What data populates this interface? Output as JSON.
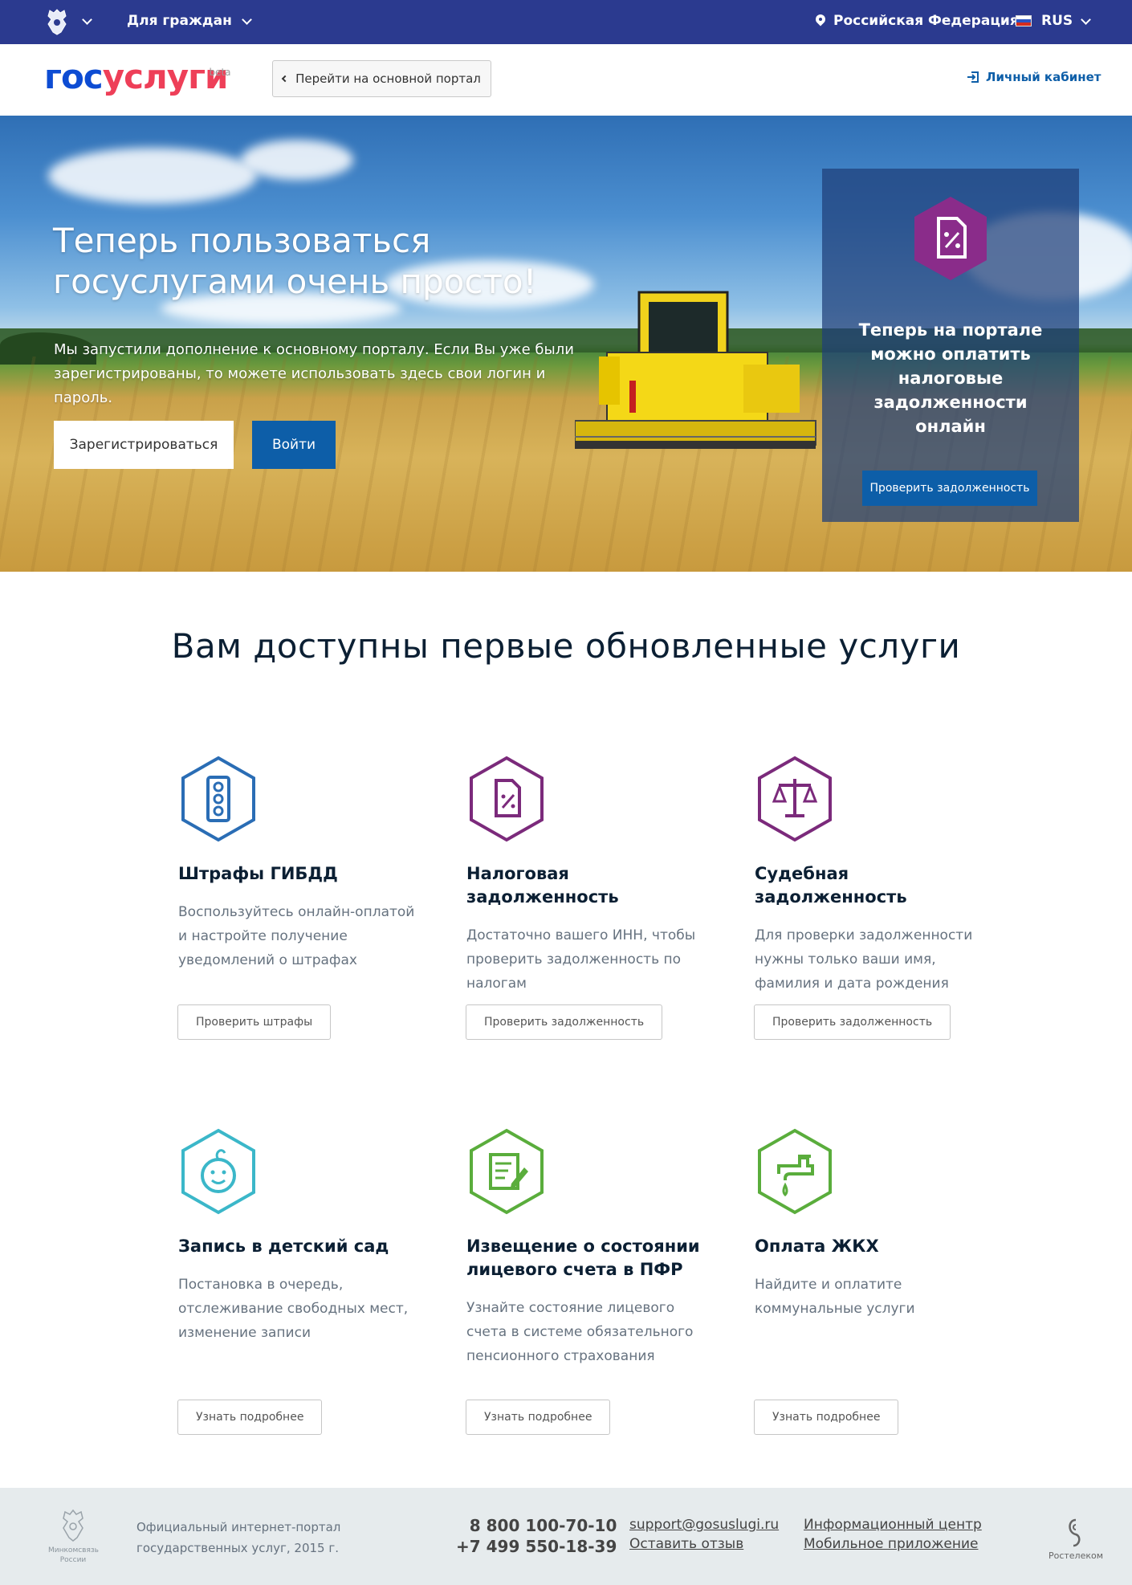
{
  "topbar": {
    "citizens_label": "Для граждан",
    "region_label": "Российская Федерация",
    "lang_label": "RUS"
  },
  "header": {
    "logo_part1": "гос",
    "logo_part2": "услуги",
    "logo_beta": "beta",
    "back_button": "Перейти на основной портал",
    "cabinet_link": "Личный кабинет"
  },
  "hero": {
    "title_line1": "Теперь пользоваться",
    "title_line2": "госуслугами очень просто!",
    "text": "Мы запустили дополнение к основному порталу. Если Вы уже были зарегистрированы, то можете использовать здесь свои логин и пароль.",
    "register_button": "Зарегистрироваться",
    "login_button": "Войти",
    "promo_title": "Теперь на портале можно оплатить налоговые задолженности онлайн",
    "promo_button": "Проверить задолженность",
    "promo_icon_color": "#8a2c8a"
  },
  "services": {
    "title": "Вам доступны первые обновленные услуги",
    "items": [
      {
        "title": "Штрафы ГИБДД",
        "desc": "Воспользуйтесь онлайн-оплатой и настройте получение уведомлений о штрафах",
        "button": "Проверить штрафы",
        "icon": "traffic-light-icon",
        "color": "#2a6db5"
      },
      {
        "title": "Налоговая задолженность",
        "desc": "Достаточно вашего ИНН, чтобы проверить задолженность по налогам",
        "button": "Проверить задолженность",
        "icon": "tax-document-icon",
        "color": "#7b2a7b"
      },
      {
        "title": "Судебная задолженность",
        "desc": "Для проверки задолженности нужны только ваши имя, фамилия и дата рождения",
        "button": "Проверить задолженность",
        "icon": "scales-icon",
        "color": "#7b2a7b"
      },
      {
        "title": "Запись в детский сад",
        "desc": "Постановка в очередь, отслеживание свободных мест, изменение записи",
        "button": "Узнать подробнее",
        "icon": "baby-icon",
        "color": "#3bb7c9"
      },
      {
        "title": "Извещение о состоянии лицевого счета в ПФР",
        "desc": "Узнайте состояние лицевого счета в системе обязательного пенсионного страхования",
        "button": "Узнать подробнее",
        "icon": "edit-document-icon",
        "color": "#5aad3c"
      },
      {
        "title": "Оплата ЖКХ",
        "desc": "Найдите и оплатите коммунальные услуги",
        "button": "Узнать подробнее",
        "icon": "water-tap-icon",
        "color": "#5aad3c"
      }
    ]
  },
  "footer": {
    "ministry_line1": "Минкомсвязь",
    "ministry_line2": "России",
    "portal_line1": "Официальный интернет-портал",
    "portal_line2": "государственных услуг, 2015 г.",
    "phone1": "8 800 100-70-10",
    "phone2": "+7 499 550-18-39",
    "email": "support@gosuslugi.ru",
    "feedback": "Оставить отзыв",
    "info_center": "Информационный центр",
    "mobile_app": "Мобильное приложение",
    "operator": "Ростелеком"
  }
}
